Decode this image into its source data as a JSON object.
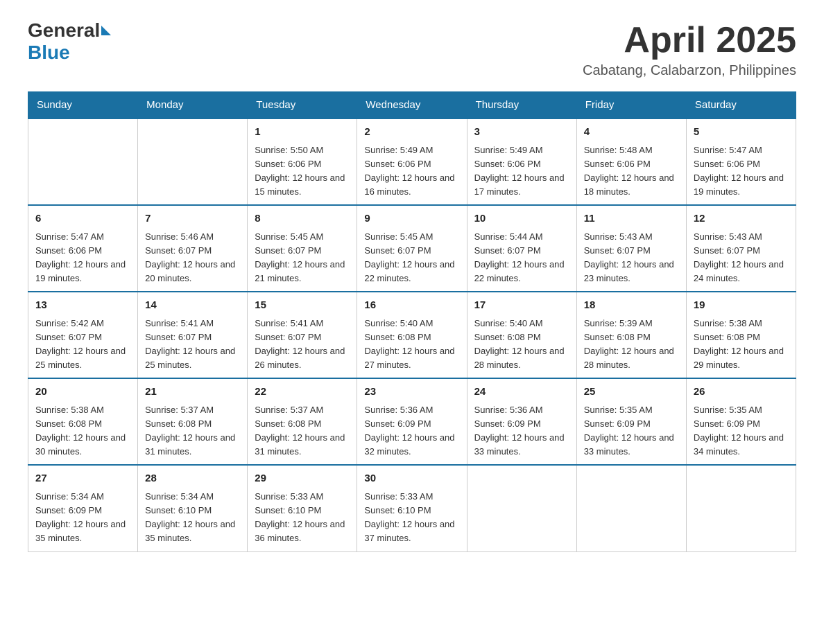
{
  "header": {
    "logo_general": "General",
    "logo_blue": "Blue",
    "month_year": "April 2025",
    "location": "Cabatang, Calabarzon, Philippines"
  },
  "weekdays": [
    "Sunday",
    "Monday",
    "Tuesday",
    "Wednesday",
    "Thursday",
    "Friday",
    "Saturday"
  ],
  "weeks": [
    [
      {
        "day": "",
        "info": ""
      },
      {
        "day": "",
        "info": ""
      },
      {
        "day": "1",
        "info": "Sunrise: 5:50 AM\nSunset: 6:06 PM\nDaylight: 12 hours\nand 15 minutes."
      },
      {
        "day": "2",
        "info": "Sunrise: 5:49 AM\nSunset: 6:06 PM\nDaylight: 12 hours\nand 16 minutes."
      },
      {
        "day": "3",
        "info": "Sunrise: 5:49 AM\nSunset: 6:06 PM\nDaylight: 12 hours\nand 17 minutes."
      },
      {
        "day": "4",
        "info": "Sunrise: 5:48 AM\nSunset: 6:06 PM\nDaylight: 12 hours\nand 18 minutes."
      },
      {
        "day": "5",
        "info": "Sunrise: 5:47 AM\nSunset: 6:06 PM\nDaylight: 12 hours\nand 19 minutes."
      }
    ],
    [
      {
        "day": "6",
        "info": "Sunrise: 5:47 AM\nSunset: 6:06 PM\nDaylight: 12 hours\nand 19 minutes."
      },
      {
        "day": "7",
        "info": "Sunrise: 5:46 AM\nSunset: 6:07 PM\nDaylight: 12 hours\nand 20 minutes."
      },
      {
        "day": "8",
        "info": "Sunrise: 5:45 AM\nSunset: 6:07 PM\nDaylight: 12 hours\nand 21 minutes."
      },
      {
        "day": "9",
        "info": "Sunrise: 5:45 AM\nSunset: 6:07 PM\nDaylight: 12 hours\nand 22 minutes."
      },
      {
        "day": "10",
        "info": "Sunrise: 5:44 AM\nSunset: 6:07 PM\nDaylight: 12 hours\nand 22 minutes."
      },
      {
        "day": "11",
        "info": "Sunrise: 5:43 AM\nSunset: 6:07 PM\nDaylight: 12 hours\nand 23 minutes."
      },
      {
        "day": "12",
        "info": "Sunrise: 5:43 AM\nSunset: 6:07 PM\nDaylight: 12 hours\nand 24 minutes."
      }
    ],
    [
      {
        "day": "13",
        "info": "Sunrise: 5:42 AM\nSunset: 6:07 PM\nDaylight: 12 hours\nand 25 minutes."
      },
      {
        "day": "14",
        "info": "Sunrise: 5:41 AM\nSunset: 6:07 PM\nDaylight: 12 hours\nand 25 minutes."
      },
      {
        "day": "15",
        "info": "Sunrise: 5:41 AM\nSunset: 6:07 PM\nDaylight: 12 hours\nand 26 minutes."
      },
      {
        "day": "16",
        "info": "Sunrise: 5:40 AM\nSunset: 6:08 PM\nDaylight: 12 hours\nand 27 minutes."
      },
      {
        "day": "17",
        "info": "Sunrise: 5:40 AM\nSunset: 6:08 PM\nDaylight: 12 hours\nand 28 minutes."
      },
      {
        "day": "18",
        "info": "Sunrise: 5:39 AM\nSunset: 6:08 PM\nDaylight: 12 hours\nand 28 minutes."
      },
      {
        "day": "19",
        "info": "Sunrise: 5:38 AM\nSunset: 6:08 PM\nDaylight: 12 hours\nand 29 minutes."
      }
    ],
    [
      {
        "day": "20",
        "info": "Sunrise: 5:38 AM\nSunset: 6:08 PM\nDaylight: 12 hours\nand 30 minutes."
      },
      {
        "day": "21",
        "info": "Sunrise: 5:37 AM\nSunset: 6:08 PM\nDaylight: 12 hours\nand 31 minutes."
      },
      {
        "day": "22",
        "info": "Sunrise: 5:37 AM\nSunset: 6:08 PM\nDaylight: 12 hours\nand 31 minutes."
      },
      {
        "day": "23",
        "info": "Sunrise: 5:36 AM\nSunset: 6:09 PM\nDaylight: 12 hours\nand 32 minutes."
      },
      {
        "day": "24",
        "info": "Sunrise: 5:36 AM\nSunset: 6:09 PM\nDaylight: 12 hours\nand 33 minutes."
      },
      {
        "day": "25",
        "info": "Sunrise: 5:35 AM\nSunset: 6:09 PM\nDaylight: 12 hours\nand 33 minutes."
      },
      {
        "day": "26",
        "info": "Sunrise: 5:35 AM\nSunset: 6:09 PM\nDaylight: 12 hours\nand 34 minutes."
      }
    ],
    [
      {
        "day": "27",
        "info": "Sunrise: 5:34 AM\nSunset: 6:09 PM\nDaylight: 12 hours\nand 35 minutes."
      },
      {
        "day": "28",
        "info": "Sunrise: 5:34 AM\nSunset: 6:10 PM\nDaylight: 12 hours\nand 35 minutes."
      },
      {
        "day": "29",
        "info": "Sunrise: 5:33 AM\nSunset: 6:10 PM\nDaylight: 12 hours\nand 36 minutes."
      },
      {
        "day": "30",
        "info": "Sunrise: 5:33 AM\nSunset: 6:10 PM\nDaylight: 12 hours\nand 37 minutes."
      },
      {
        "day": "",
        "info": ""
      },
      {
        "day": "",
        "info": ""
      },
      {
        "day": "",
        "info": ""
      }
    ]
  ]
}
